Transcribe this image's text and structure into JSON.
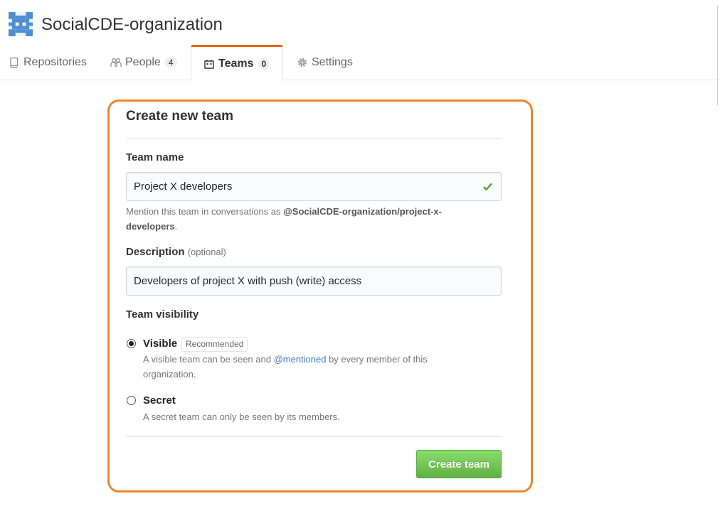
{
  "org": {
    "name": "SocialCDE-organization"
  },
  "tabs": [
    {
      "label": "Repositories",
      "icon": "repo-icon"
    },
    {
      "label": "People",
      "icon": "people-icon",
      "count": "4"
    },
    {
      "label": "Teams",
      "icon": "teams-icon",
      "count": "0",
      "selected": true
    },
    {
      "label": "Settings",
      "icon": "gear-icon"
    }
  ],
  "form": {
    "title": "Create new team",
    "team_name": {
      "label": "Team name",
      "value": "Project X developers",
      "valid_icon": "check-icon"
    },
    "mention_note": {
      "prefix": "Mention this team in conversations as ",
      "handle": "@SocialCDE-organization/project-x-developers",
      "suffix": "."
    },
    "description": {
      "label": "Description",
      "optional": "(optional)",
      "value": "Developers of project X with push (write) access"
    },
    "visibility": {
      "label": "Team visibility",
      "visible": {
        "label": "Visible",
        "badge": "Recommended",
        "desc_before": "A visible team can be seen and ",
        "desc_link": "@mentioned",
        "desc_after": " by every member of this organization.",
        "checked": true
      },
      "secret": {
        "label": "Secret",
        "desc": "A secret team can only be seen by its members.",
        "checked": false
      }
    },
    "submit_label": "Create team"
  },
  "colors": {
    "accent_orange": "#f0842c",
    "tab_active": "#e36209",
    "button_green": "#60b044",
    "link_blue": "#4078c0",
    "check_green": "#55a532",
    "avatar_blue": "#4f8fd1"
  }
}
